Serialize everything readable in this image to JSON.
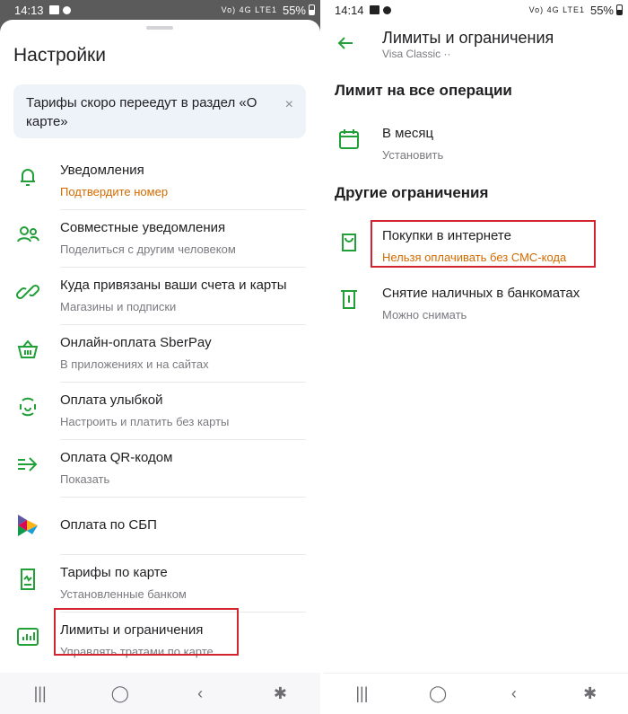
{
  "left": {
    "status": {
      "time": "14:13",
      "signal": "Vo) 4G LTE1",
      "battery": "55%"
    },
    "sheet_title": "Настройки",
    "banner": {
      "text": "Тарифы скоро переедут в раздел «О карте»",
      "close": "×"
    },
    "items": [
      {
        "title": "Уведомления",
        "subtitle": "Подтвердите номер",
        "icon": "bell-icon"
      },
      {
        "title": "Совместные уведомления",
        "subtitle": "Поделиться с другим человеком",
        "icon": "people-icon"
      },
      {
        "title": "Куда привязаны ваши счета и карты",
        "subtitle": "Магазины и подписки",
        "icon": "link-icon"
      },
      {
        "title": "Онлайн-оплата SberPay",
        "subtitle": "В приложениях и на сайтах",
        "icon": "basket-icon"
      },
      {
        "title": "Оплата улыбкой",
        "subtitle": "Настроить и платить без карты",
        "icon": "smile-icon"
      },
      {
        "title": "Оплата QR-кодом",
        "subtitle": "Показать",
        "icon": "qr-arrow-icon"
      },
      {
        "title": "Оплата по СБП",
        "subtitle": "",
        "icon": "sbp-logo-icon"
      },
      {
        "title": "Тарифы по карте",
        "subtitle": "Установленные банком",
        "icon": "tariff-doc-icon"
      },
      {
        "title": "Лимиты и ограничения",
        "subtitle": "Управлять тратами по карте",
        "icon": "chart-icon"
      }
    ],
    "nav": {
      "recent": "|||",
      "home": "◯",
      "back": "‹",
      "accessibility": "✱"
    }
  },
  "right": {
    "status": {
      "time": "14:14",
      "signal": "Vo) 4G LTE1",
      "battery": "55%"
    },
    "title": "Лимиты и ограничения",
    "subtitle": "Visa Classic ··",
    "section_all": "Лимит на все операции",
    "month": {
      "title": "В месяц",
      "subtitle": "Установить"
    },
    "section_other": "Другие ограничения",
    "internet": {
      "title": "Покупки в интернете",
      "subtitle": "Нельзя оплачивать без СМС-кода"
    },
    "cash": {
      "title": "Снятие наличных в банкоматах",
      "subtitle": "Можно снимать"
    },
    "nav": {
      "recent": "|||",
      "home": "◯",
      "back": "‹",
      "accessibility": "✱"
    }
  },
  "colors": {
    "accent": "#21a038",
    "warning": "#d46b00",
    "highlight": "#d3252f"
  }
}
